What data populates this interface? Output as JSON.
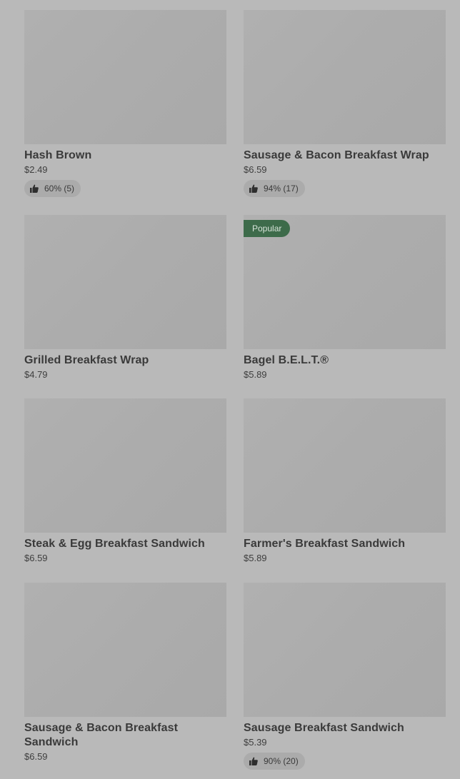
{
  "items": [
    {
      "name": "Hash Brown",
      "price": "$2.49",
      "rating": "60% (5)"
    },
    {
      "name": "Sausage & Bacon Breakfast Wrap",
      "price": "$6.59",
      "rating": "94% (17)"
    },
    {
      "name": "Grilled Breakfast Wrap",
      "price": "$4.79"
    },
    {
      "name": "Bagel B.E.L.T.®",
      "price": "$5.89",
      "badge": "Popular"
    },
    {
      "name": "Steak & Egg Breakfast Sandwich",
      "price": "$6.59"
    },
    {
      "name": "Farmer's Breakfast Sandwich",
      "price": "$5.89"
    },
    {
      "name": "Sausage & Bacon Breakfast Sandwich",
      "price": "$6.59"
    },
    {
      "name": "Sausage Breakfast Sandwich",
      "price": "$5.39",
      "rating": "90% (20)"
    }
  ],
  "colors": {
    "page_background": "#b9b9b9",
    "badge_background": "#3d6b4a",
    "text": "#3a3a3a"
  },
  "icons": {
    "rating": "thumbs-up-icon"
  }
}
